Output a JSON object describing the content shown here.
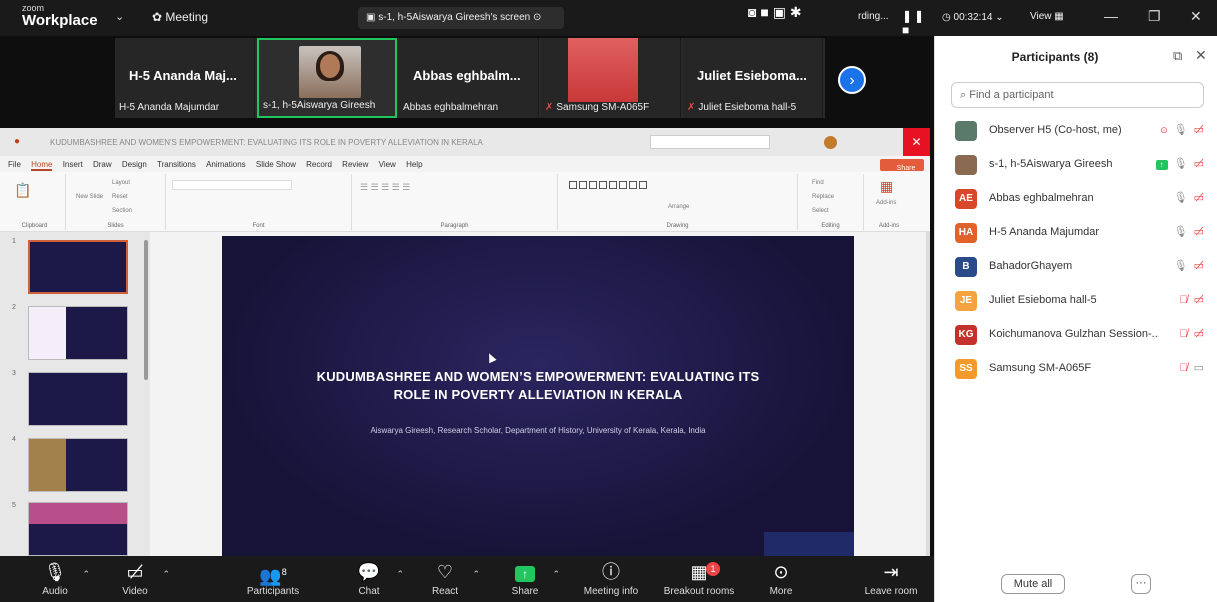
{
  "topbar": {
    "logo_small": "zoom",
    "logo_big": "Workplace",
    "meeting_label": "Meeting",
    "share_pill": "s-1, h-5Aiswarya Gireesh's screen",
    "recording_text": "rding...",
    "timer": "00:32:14",
    "view_label": "View"
  },
  "strip": {
    "tiles": [
      {
        "big": "H-5 Ananda Maj...",
        "cap": "H-5 Ananda Majumdar"
      },
      {
        "big": "",
        "cap": "s-1, h-5Aiswarya Gireesh"
      },
      {
        "big": "Abbas eghbalm...",
        "cap": "Abbas eghbalmehran"
      },
      {
        "big": "",
        "cap": "Samsung SM-A065F"
      },
      {
        "big": "Juliet Esieboma...",
        "cap": "Juliet Esieboma hall-5"
      }
    ]
  },
  "ppt": {
    "title_text": "KUDUMBASHREE AND WOMEN'S EMPOWERMENT: EVALUATING ITS ROLE IN POVERTY ALLEVIATION IN KERALA",
    "share_label": "Share",
    "menu": [
      "File",
      "Home",
      "Insert",
      "Draw",
      "Design",
      "Transitions",
      "Animations",
      "Slide Show",
      "Record",
      "Review",
      "View",
      "Help"
    ],
    "ribbon_groups": [
      "Clipboard",
      "Slides",
      "Font",
      "Paragraph",
      "Drawing",
      "Editing",
      "Add-ins"
    ],
    "ribbon_small": {
      "new_slide": "New Slide",
      "layout": "Layout",
      "reset": "Reset",
      "section": "Section",
      "arrange": "Arrange",
      "find": "Find",
      "replace": "Replace",
      "select": "Select",
      "addins": "Add-ins"
    },
    "thumb_numbers": [
      "1",
      "2",
      "3",
      "4",
      "5"
    ],
    "slide": {
      "title_line1": "KUDUMBASHREE AND WOMEN’S EMPOWERMENT: EVALUATING ITS",
      "title_line2": "ROLE IN POVERTY ALLEVIATION IN KERALA",
      "subtitle": "Aiswarya Gireesh, Research Scholar, Department of History, University of Kerala, Kerala, India"
    }
  },
  "toolbar": {
    "audio": "Audio",
    "video": "Video",
    "participants": "Participants",
    "participants_count": "8",
    "chat": "Chat",
    "react": "React",
    "share": "Share",
    "meeting_info": "Meeting info",
    "breakout": "Breakout rooms",
    "breakout_badge": "1",
    "more": "More",
    "leave": "Leave room"
  },
  "panel": {
    "title": "Participants (8)",
    "search_placeholder": "Find a participant",
    "participants": [
      {
        "initials": "",
        "name": "Observer H5 (Co-host, me)",
        "color": "#5a7a6a"
      },
      {
        "initials": "",
        "name": "s-1, h-5Aiswarya Gireesh",
        "color": "#8a6a50"
      },
      {
        "initials": "AE",
        "name": "Abbas eghbalmehran",
        "color": "#d9472b"
      },
      {
        "initials": "HA",
        "name": "H-5 Ananda Majumdar",
        "color": "#e2632a"
      },
      {
        "initials": "B",
        "name": "BahadorGhayem",
        "color": "#2a4a8a"
      },
      {
        "initials": "JE",
        "name": "Juliet Esieboma  hall-5",
        "color": "#f4a340"
      },
      {
        "initials": "KG",
        "name": "Koichumanova Gulzhan Session-...",
        "color": "#c4302b"
      },
      {
        "initials": "SS",
        "name": "Samsung SM-A065F",
        "color": "#f39a2b"
      }
    ],
    "mute_all": "Mute all",
    "more_dots": "···"
  }
}
